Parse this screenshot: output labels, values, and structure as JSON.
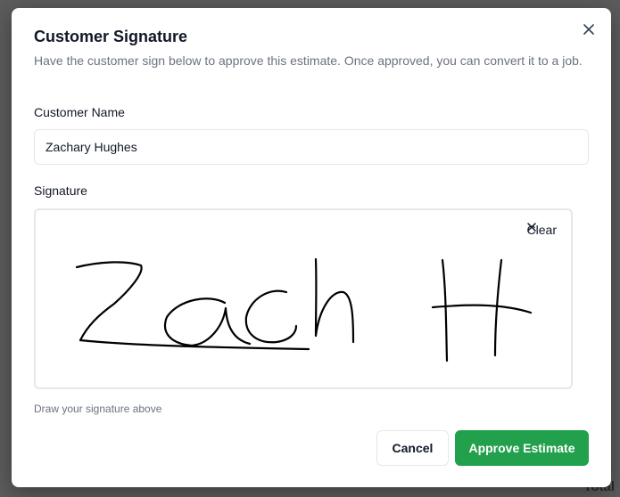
{
  "modal": {
    "title": "Customer Signature",
    "description": "Have the customer sign below to approve this estimate. Once approved, you can convert it to a job.",
    "close_icon": "close-icon"
  },
  "customer_name": {
    "label": "Customer Name",
    "value": "Zachary Hughes"
  },
  "signature": {
    "label": "Signature",
    "clear_label": "Clear",
    "clear_icon": "x-icon",
    "hint": "Draw your signature above"
  },
  "actions": {
    "cancel_label": "Cancel",
    "approve_label": "Approve Estimate"
  },
  "colors": {
    "primary": "#22a04b",
    "text": "#111827",
    "muted": "#6b7280",
    "border": "#e5e7eb"
  },
  "background": {
    "partial_text": "Total"
  }
}
